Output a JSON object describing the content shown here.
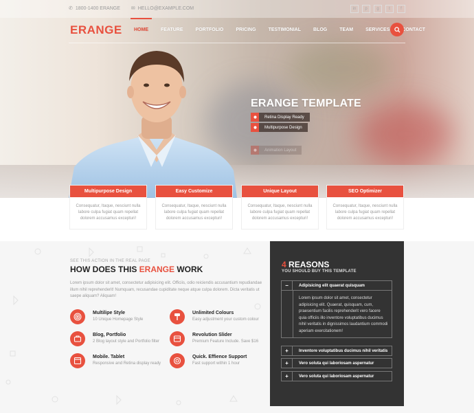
{
  "topbar": {
    "phone": "1800-1400 ERANGE",
    "email": "HELLO@EXAMPLE.COM",
    "socials": [
      "in",
      "p",
      "g",
      "t",
      "f"
    ]
  },
  "nav": {
    "logo": "ERANGE",
    "items": [
      "HOME",
      "FEATURE",
      "PORTFOLIO",
      "PRICING",
      "TESTIMONIAL",
      "BLOG",
      "TEAM",
      "SERVICES",
      "CONTACT"
    ],
    "active": "HOME"
  },
  "hero": {
    "title": "ERANGE TEMPLATE",
    "features": [
      "Retina Display Ready",
      "Multipurpose Design",
      "Animation Layout"
    ]
  },
  "cards": [
    {
      "title": "Multipurpose Design",
      "text": "Consequatur, Itaque, nesciunt nulla labore culpa fugiat quam repellat dolorem accusamus excepturi!"
    },
    {
      "title": "Easy Customize",
      "text": "Consequatur, Itaque, nesciunt nulla labore culpa fugiat quam repellat dolorem accusamus excepturi!"
    },
    {
      "title": "Unique Layout",
      "text": "Consequatur, Itaque, nesciunt nulla labore culpa fugiat quam repellat dolorem accusamus excepturi!"
    },
    {
      "title": "SEO Optimizer",
      "text": "Consequatur, Itaque, nesciunt nulla labore culpa fugiat quam repellat dolorem accusamus excepturi!"
    }
  ],
  "work": {
    "pre": "SEE THIS ACTION IN THE REAL PAGE",
    "title_a": "HOW DOES THIS ",
    "title_b": "ERANGE",
    "title_c": " WORK",
    "intro": "Lorem ipsum dolor sit amet, consectetur adipisicing elit. Officiis, odio reiciendis accusantium repudiandae illum nihil reprehenderit! Numquam, recusandae cupiditate neque atque culpa dolorem. Dicta veritatis ut saepe aliquam? Aliquam!",
    "services": [
      {
        "title": "Multilipe Style",
        "sub": "10 Unique Homepage Style",
        "icon": "fingerprint-icon"
      },
      {
        "title": "Unlimited Colours",
        "sub": "Easy adjustment your custom colour",
        "icon": "paint-roller-icon"
      },
      {
        "title": "Blog, Portfolio",
        "sub": "2 Blog layout style and Portfolio filter",
        "icon": "briefcase-icon"
      },
      {
        "title": "Revolution Slider",
        "sub": "Premium Feature Include. Save $16",
        "icon": "slider-icon"
      },
      {
        "title": "Mobile. Tablet",
        "sub": "Responsive and Retina display ready",
        "icon": "browser-icon"
      },
      {
        "title": "Quick. Effience Support",
        "sub": "Fast support within 1 hour",
        "icon": "support-icon"
      }
    ]
  },
  "reasons": {
    "num": "4",
    "title": "REASONS",
    "sub": "YOU SHOULD BUY THIS TEMPLATE",
    "open": {
      "label": "Adipisicing elit quaerat quisquam",
      "sign": "−"
    },
    "body": "Lorem ipsum dolor sit amet, consectetur adipisicing elit. Quaerat, quisquam, cum, praesentium facilis reprehenderit vero facere quia officiis illo inventore voluptatibus ducimus nihil veritatis in dignissimos laudantium commodi aperiam exercitationem!",
    "items": [
      {
        "label": "Inventore voluptatibus ducimus nihil veritatis",
        "sign": "+"
      },
      {
        "label": "Vero soluta qui laboriosam aspernatur",
        "sign": "+"
      },
      {
        "label": "Vero soluta qui laboriosam aspernatur",
        "sign": "+"
      }
    ]
  },
  "colors": {
    "accent": "#e8513f",
    "dark": "#333333"
  }
}
